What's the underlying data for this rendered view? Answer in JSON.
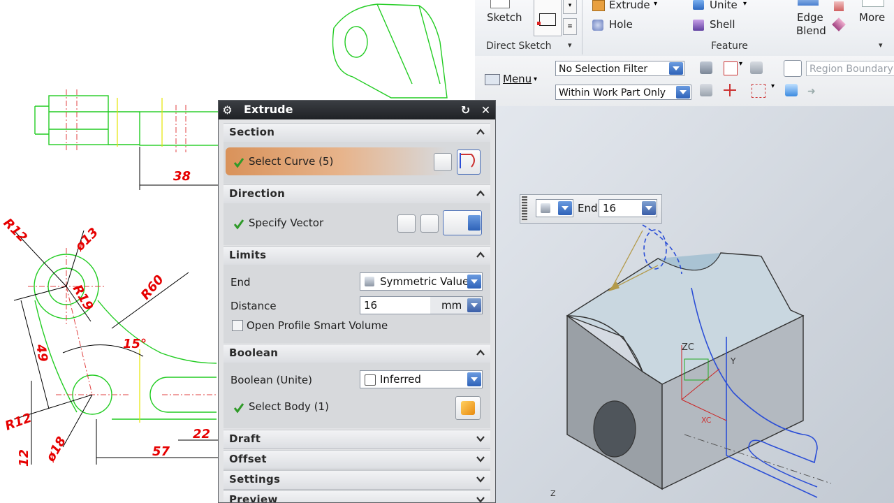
{
  "drawing": {
    "dimensions": [
      "38",
      "R12",
      "ø13",
      "R19",
      "R60",
      "15°",
      "49",
      "R12",
      "12",
      "ø18",
      "57",
      "22"
    ]
  },
  "ribbon": {
    "sketch_label": "Sketch",
    "direct_sketch_group": "Direct Sketch",
    "extrude_label": "Extrude",
    "hole_label": "Hole",
    "unite_label": "Unite",
    "shell_label": "Shell",
    "edge_blend_label_1": "Edge",
    "edge_blend_label_2": "Blend",
    "more_label": "More",
    "feature_group": "Feature"
  },
  "toolbar": {
    "menu_label": "Menu",
    "selection_filter": "No Selection Filter",
    "scope_filter": "Within Work Part Only",
    "region_boundary_placeholder": "Region Boundary"
  },
  "end_widget": {
    "label": "End",
    "value": "16"
  },
  "viewport": {
    "zc_label": "ZC",
    "y_label": "Y",
    "xc_label": "XC",
    "z_label": "Z"
  },
  "dialog": {
    "title": "Extrude",
    "section": {
      "header": "Section",
      "select_curve": "Select Curve (5)"
    },
    "direction": {
      "header": "Direction",
      "specify_vector": "Specify Vector"
    },
    "limits": {
      "header": "Limits",
      "end_label": "End",
      "end_value": "Symmetric Value",
      "distance_label": "Distance",
      "distance_value": "16",
      "distance_unit": "mm",
      "open_profile_label": "Open Profile Smart Volume"
    },
    "boolean": {
      "header": "Boolean",
      "boolean_label": "Boolean (Unite)",
      "boolean_value": "Inferred",
      "select_body": "Select Body (1)"
    },
    "collapsed_sections": [
      "Draft",
      "Offset",
      "Settings",
      "Preview"
    ]
  },
  "colors": {
    "title_bar": "#2b2e33",
    "highlight": "#e0a070",
    "combo_button": "#2e62b8",
    "drawing_lines": "#22cc22",
    "dimension_text": "#e60000",
    "model_face": "#b9c3cc"
  }
}
